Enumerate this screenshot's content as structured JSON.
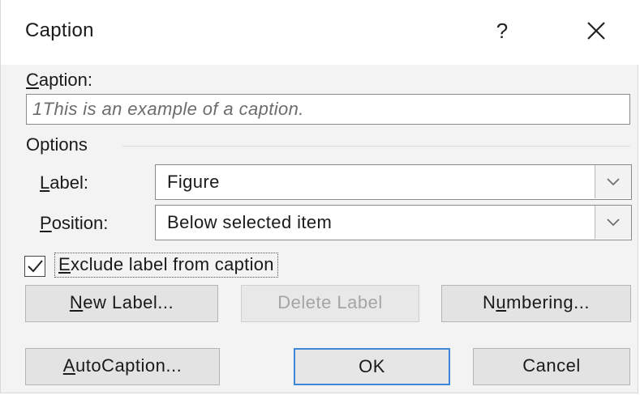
{
  "window": {
    "title": "Caption",
    "help_label": "?",
    "close_icon": "close-icon"
  },
  "caption": {
    "label_accel": "C",
    "label_rest": "aption:",
    "value": "1This is an example of a caption."
  },
  "options": {
    "title": "Options",
    "label_field": {
      "label_accel": "L",
      "label_rest": "abel:",
      "value": "Figure"
    },
    "position_field": {
      "label_accel": "P",
      "label_rest": "osition:",
      "value": "Below selected item"
    }
  },
  "exclude": {
    "checked": true,
    "label_accel": "E",
    "label_rest": "xclude label from caption"
  },
  "buttons": {
    "new_label": {
      "accel": "N",
      "rest": "ew Label..."
    },
    "delete_label": "Delete Label",
    "numbering": {
      "pre": "N",
      "accel": "u",
      "rest": "mbering..."
    },
    "autocaption": {
      "accel": "A",
      "rest": "utoCaption..."
    },
    "ok": "OK",
    "cancel": "Cancel"
  },
  "colors": {
    "default_button_border": "#3c87d6",
    "disabled_text": "#a5a5a5"
  }
}
